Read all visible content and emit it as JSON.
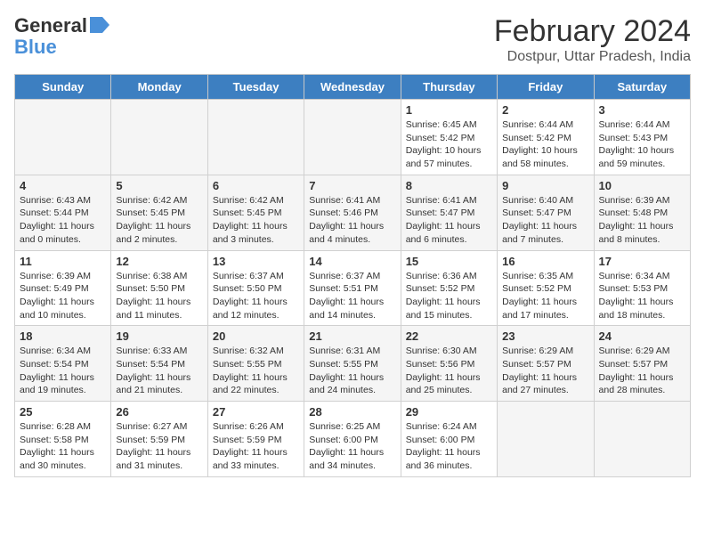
{
  "header": {
    "logo_general": "General",
    "logo_blue": "Blue",
    "title": "February 2024",
    "subtitle": "Dostpur, Uttar Pradesh, India"
  },
  "days_of_week": [
    "Sunday",
    "Monday",
    "Tuesday",
    "Wednesday",
    "Thursday",
    "Friday",
    "Saturday"
  ],
  "weeks": [
    [
      {
        "day": "",
        "info": ""
      },
      {
        "day": "",
        "info": ""
      },
      {
        "day": "",
        "info": ""
      },
      {
        "day": "",
        "info": ""
      },
      {
        "day": "1",
        "info": "Sunrise: 6:45 AM\nSunset: 5:42 PM\nDaylight: 10 hours and 57 minutes."
      },
      {
        "day": "2",
        "info": "Sunrise: 6:44 AM\nSunset: 5:42 PM\nDaylight: 10 hours and 58 minutes."
      },
      {
        "day": "3",
        "info": "Sunrise: 6:44 AM\nSunset: 5:43 PM\nDaylight: 10 hours and 59 minutes."
      }
    ],
    [
      {
        "day": "4",
        "info": "Sunrise: 6:43 AM\nSunset: 5:44 PM\nDaylight: 11 hours and 0 minutes."
      },
      {
        "day": "5",
        "info": "Sunrise: 6:42 AM\nSunset: 5:45 PM\nDaylight: 11 hours and 2 minutes."
      },
      {
        "day": "6",
        "info": "Sunrise: 6:42 AM\nSunset: 5:45 PM\nDaylight: 11 hours and 3 minutes."
      },
      {
        "day": "7",
        "info": "Sunrise: 6:41 AM\nSunset: 5:46 PM\nDaylight: 11 hours and 4 minutes."
      },
      {
        "day": "8",
        "info": "Sunrise: 6:41 AM\nSunset: 5:47 PM\nDaylight: 11 hours and 6 minutes."
      },
      {
        "day": "9",
        "info": "Sunrise: 6:40 AM\nSunset: 5:47 PM\nDaylight: 11 hours and 7 minutes."
      },
      {
        "day": "10",
        "info": "Sunrise: 6:39 AM\nSunset: 5:48 PM\nDaylight: 11 hours and 8 minutes."
      }
    ],
    [
      {
        "day": "11",
        "info": "Sunrise: 6:39 AM\nSunset: 5:49 PM\nDaylight: 11 hours and 10 minutes."
      },
      {
        "day": "12",
        "info": "Sunrise: 6:38 AM\nSunset: 5:50 PM\nDaylight: 11 hours and 11 minutes."
      },
      {
        "day": "13",
        "info": "Sunrise: 6:37 AM\nSunset: 5:50 PM\nDaylight: 11 hours and 12 minutes."
      },
      {
        "day": "14",
        "info": "Sunrise: 6:37 AM\nSunset: 5:51 PM\nDaylight: 11 hours and 14 minutes."
      },
      {
        "day": "15",
        "info": "Sunrise: 6:36 AM\nSunset: 5:52 PM\nDaylight: 11 hours and 15 minutes."
      },
      {
        "day": "16",
        "info": "Sunrise: 6:35 AM\nSunset: 5:52 PM\nDaylight: 11 hours and 17 minutes."
      },
      {
        "day": "17",
        "info": "Sunrise: 6:34 AM\nSunset: 5:53 PM\nDaylight: 11 hours and 18 minutes."
      }
    ],
    [
      {
        "day": "18",
        "info": "Sunrise: 6:34 AM\nSunset: 5:54 PM\nDaylight: 11 hours and 19 minutes."
      },
      {
        "day": "19",
        "info": "Sunrise: 6:33 AM\nSunset: 5:54 PM\nDaylight: 11 hours and 21 minutes."
      },
      {
        "day": "20",
        "info": "Sunrise: 6:32 AM\nSunset: 5:55 PM\nDaylight: 11 hours and 22 minutes."
      },
      {
        "day": "21",
        "info": "Sunrise: 6:31 AM\nSunset: 5:55 PM\nDaylight: 11 hours and 24 minutes."
      },
      {
        "day": "22",
        "info": "Sunrise: 6:30 AM\nSunset: 5:56 PM\nDaylight: 11 hours and 25 minutes."
      },
      {
        "day": "23",
        "info": "Sunrise: 6:29 AM\nSunset: 5:57 PM\nDaylight: 11 hours and 27 minutes."
      },
      {
        "day": "24",
        "info": "Sunrise: 6:29 AM\nSunset: 5:57 PM\nDaylight: 11 hours and 28 minutes."
      }
    ],
    [
      {
        "day": "25",
        "info": "Sunrise: 6:28 AM\nSunset: 5:58 PM\nDaylight: 11 hours and 30 minutes."
      },
      {
        "day": "26",
        "info": "Sunrise: 6:27 AM\nSunset: 5:59 PM\nDaylight: 11 hours and 31 minutes."
      },
      {
        "day": "27",
        "info": "Sunrise: 6:26 AM\nSunset: 5:59 PM\nDaylight: 11 hours and 33 minutes."
      },
      {
        "day": "28",
        "info": "Sunrise: 6:25 AM\nSunset: 6:00 PM\nDaylight: 11 hours and 34 minutes."
      },
      {
        "day": "29",
        "info": "Sunrise: 6:24 AM\nSunset: 6:00 PM\nDaylight: 11 hours and 36 minutes."
      },
      {
        "day": "",
        "info": ""
      },
      {
        "day": "",
        "info": ""
      }
    ]
  ]
}
